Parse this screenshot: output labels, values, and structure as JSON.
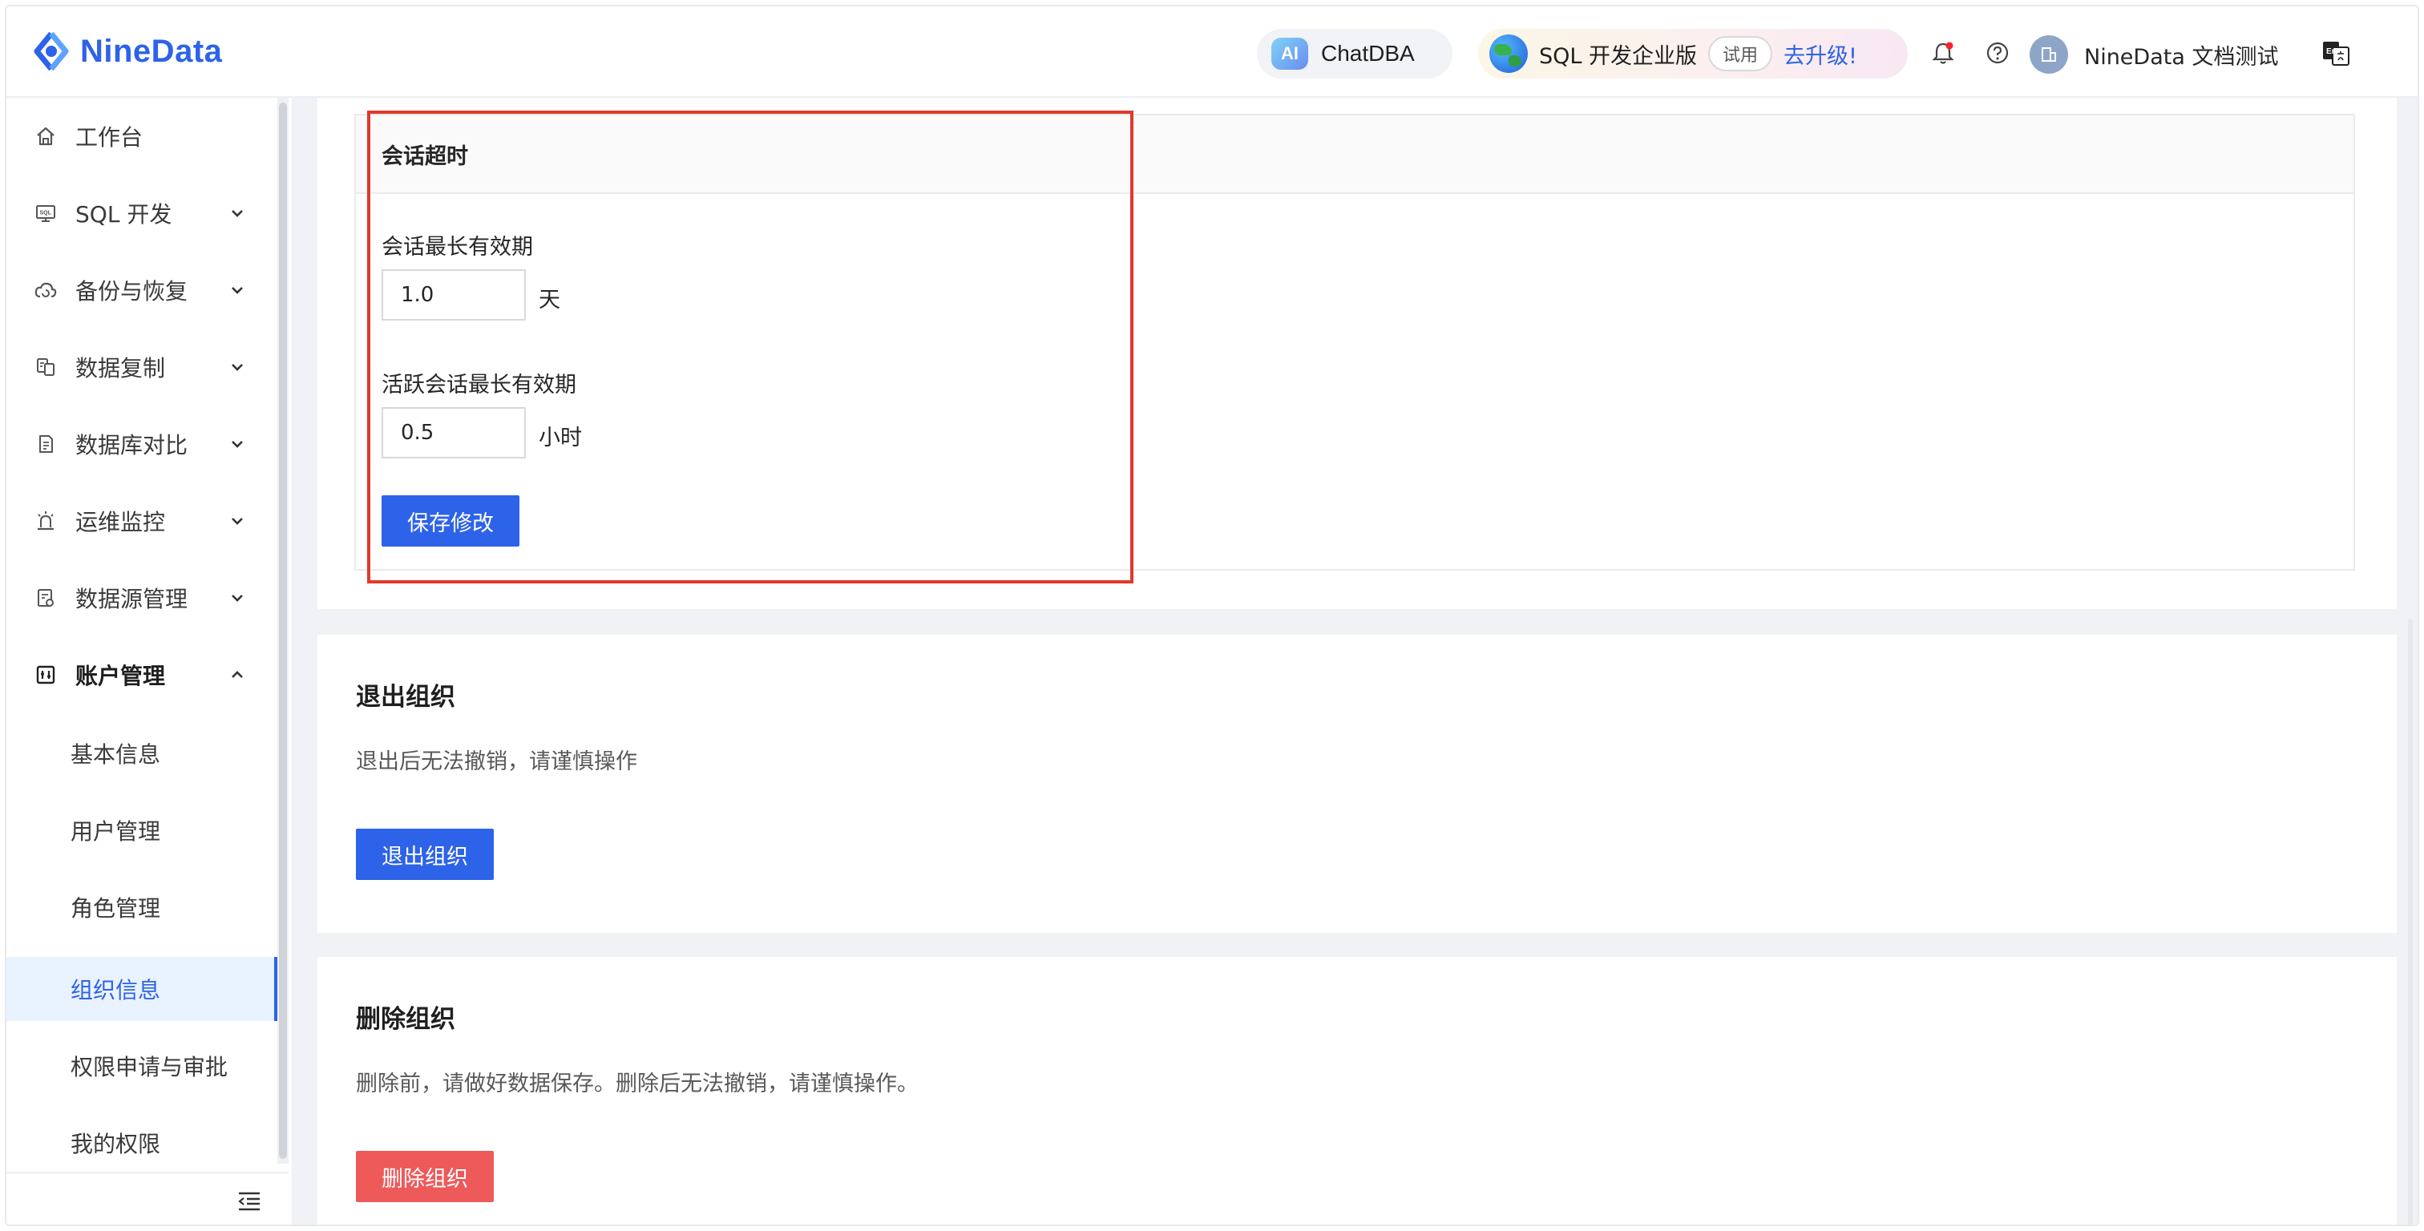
{
  "header": {
    "logo_text": "NineData",
    "chatdba": {
      "badge": "AI",
      "label": "ChatDBA"
    },
    "edition": {
      "label": "SQL 开发企业版",
      "trial": "试用",
      "upgrade": "去升级!"
    },
    "user_name": "NineData 文档测试",
    "icons": [
      "bell-icon",
      "help-icon",
      "org-avatar-icon",
      "language-switch-icon"
    ]
  },
  "sidebar": {
    "items": [
      {
        "label": "工作台",
        "icon": "home-icon"
      },
      {
        "label": "SQL 开发",
        "icon": "sql-icon"
      },
      {
        "label": "备份与恢复",
        "icon": "cloud-backup-icon"
      },
      {
        "label": "数据复制",
        "icon": "copy-icon"
      },
      {
        "label": "数据库对比",
        "icon": "compare-icon"
      },
      {
        "label": "运维监控",
        "icon": "alarm-icon"
      },
      {
        "label": "数据源管理",
        "icon": "datasource-icon"
      },
      {
        "label": "账户管理",
        "icon": "account-icon"
      }
    ],
    "sub_items": [
      {
        "label": "基本信息"
      },
      {
        "label": "用户管理"
      },
      {
        "label": "角色管理"
      },
      {
        "label": "组织信息",
        "active": true
      },
      {
        "label": "权限申请与审批"
      },
      {
        "label": "我的权限"
      }
    ]
  },
  "session_timeout": {
    "title": "会话超时",
    "max_validity_label": "会话最长有效期",
    "max_validity_value": "1.0",
    "max_validity_unit": "天",
    "active_validity_label": "活跃会话最长有效期",
    "active_validity_value": "0.5",
    "active_validity_unit": "小时",
    "save_button": "保存修改"
  },
  "leave_org": {
    "title": "退出组织",
    "description": "退出后无法撤销，请谨慎操作",
    "button": "退出组织"
  },
  "delete_org": {
    "title": "删除组织",
    "description": "删除前，请做好数据保存。删除后无法撤销，请谨慎操作。",
    "button": "删除组织"
  },
  "colors": {
    "primary": "#2d63e8",
    "danger": "#ee5a5a",
    "highlight_border": "#e0392b",
    "active_bg": "#e9f2ff"
  }
}
